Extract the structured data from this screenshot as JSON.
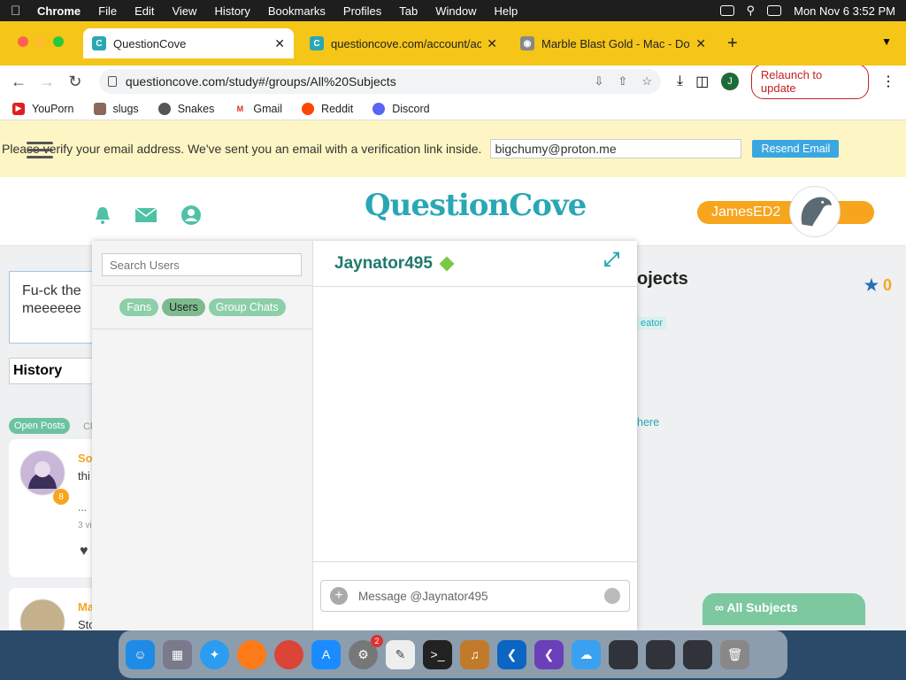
{
  "menubar": {
    "app": "Chrome",
    "items": [
      "File",
      "Edit",
      "View",
      "History",
      "Bookmarks",
      "Profiles",
      "Tab",
      "Window",
      "Help"
    ],
    "datetime": "Mon Nov 6  3:52 PM"
  },
  "tabs": [
    {
      "title": "QuestionCove"
    },
    {
      "title": "questioncove.com/account/act"
    },
    {
      "title": "Marble Blast Gold - Mac - Dow"
    }
  ],
  "toolbar": {
    "url": "questioncove.com/study#/groups/All%20Subjects",
    "profile_initial": "J",
    "relaunch": "Relaunch to update"
  },
  "bookmarks": [
    "YouPorn",
    "slugs",
    "Snakes",
    "Gmail",
    "Reddit",
    "Discord"
  ],
  "verify": {
    "message": "Please verify your email address. We've sent you an email with a verification link inside.",
    "email": "bigchumy@proton.me",
    "resend": "Resend Email"
  },
  "header": {
    "logo": "QuestionCove",
    "username": "JamesED2"
  },
  "feed": {
    "post_text": "Fu-ck the meeeeee",
    "history_label": "History",
    "open_posts": "Open Posts",
    "tab_cut": "Cl",
    "card1": {
      "name": "So",
      "line": "thi",
      "dots": "...",
      "meta": "3 vi",
      "level": "8"
    },
    "card2": {
      "name": "Ma",
      "line": "Sto"
    }
  },
  "right": {
    "title": "ojects",
    "star_count": "0",
    "tag": "eator",
    "link": "here",
    "all_subjects": "All Subjects"
  },
  "chat": {
    "search_placeholder": "Search Users",
    "tabs": [
      "Fans",
      "Users",
      "Group Chats"
    ],
    "active_tab": "Users",
    "recipient": "Jaynator495",
    "message_placeholder": "Message @Jaynator495"
  },
  "dock": {
    "badge_count": "2"
  },
  "colors": {
    "tabstrip": "#f5c518",
    "accent_teal": "#2aa7b5",
    "user_pill": "#f7a51c",
    "chat_green": "#8ccfa8"
  }
}
